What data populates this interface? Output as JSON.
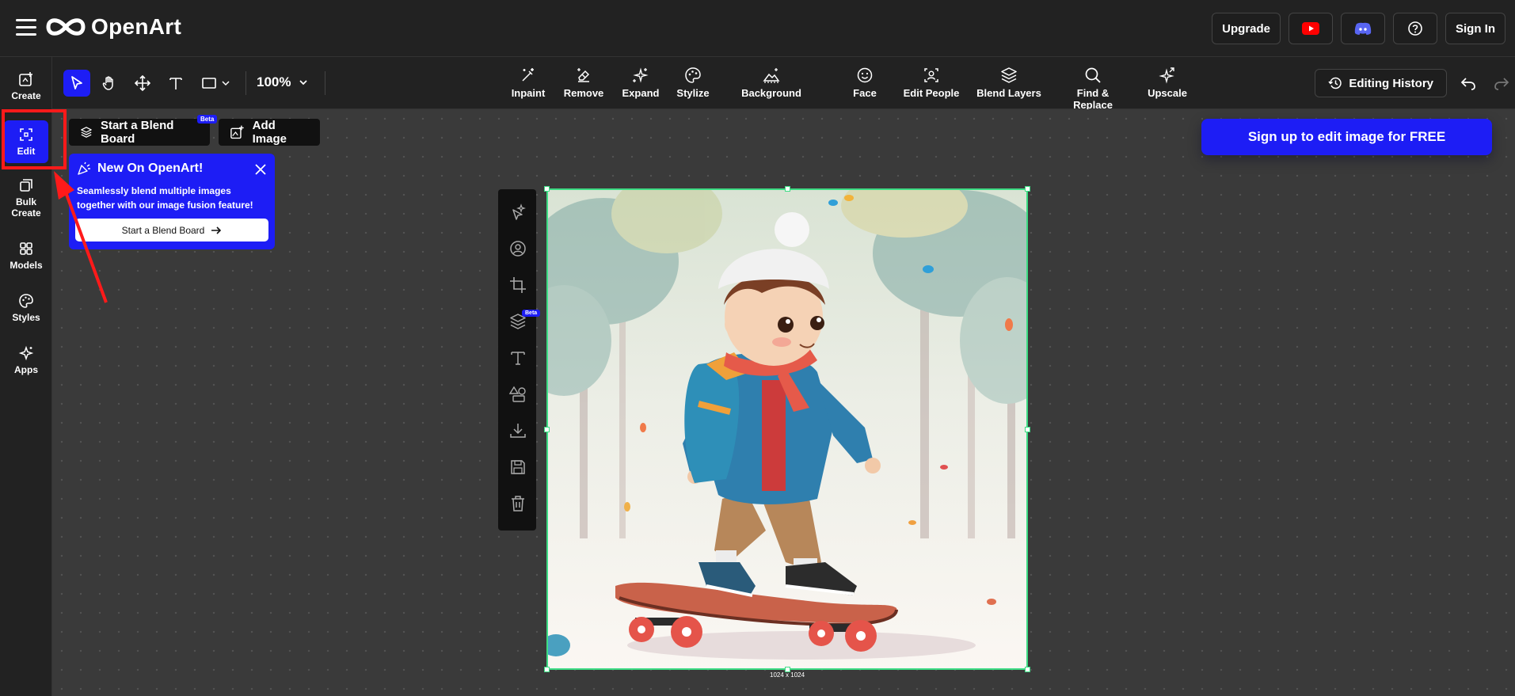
{
  "header": {
    "logo_text": "OpenArt",
    "upgrade_label": "Upgrade",
    "sign_in_label": "Sign In",
    "youtube_icon": "youtube-icon",
    "discord_icon": "discord-icon",
    "help_icon": "help-icon"
  },
  "sidebar": {
    "items": [
      {
        "label": "Create",
        "icon": "create-icon"
      },
      {
        "label": "Edit",
        "icon": "edit-icon",
        "active": true
      },
      {
        "label": "Bulk Create",
        "icon": "bulk-create-icon"
      },
      {
        "label": "Models",
        "icon": "models-icon"
      },
      {
        "label": "Styles",
        "icon": "styles-icon"
      },
      {
        "label": "Apps",
        "icon": "apps-icon"
      }
    ]
  },
  "toolbar": {
    "zoom_value": "100%",
    "features": [
      {
        "label": "Inpaint",
        "icon": "inpaint-icon"
      },
      {
        "label": "Remove",
        "icon": "remove-icon"
      },
      {
        "label": "Expand",
        "icon": "expand-icon"
      },
      {
        "label": "Stylize",
        "icon": "stylize-icon"
      },
      {
        "label": "Background",
        "icon": "background-icon"
      },
      {
        "label": "Face",
        "icon": "face-icon"
      },
      {
        "label": "Edit People",
        "icon": "edit-people-icon"
      },
      {
        "label": "Blend Layers",
        "icon": "blend-layers-icon"
      },
      {
        "label": "Find & Replace",
        "icon": "find-replace-icon"
      },
      {
        "label": "Upscale",
        "icon": "upscale-icon"
      }
    ],
    "editing_history_label": "Editing History"
  },
  "canvas": {
    "blend_board_label": "Start a Blend Board",
    "blend_board_badge": "Beta",
    "add_image_label": "Add Image",
    "layer_badge": "Beta",
    "signup_label": "Sign up to edit image for FREE",
    "image_dimensions": "1024 x 1024"
  },
  "popup": {
    "title": "New On OpenArt!",
    "text": "Seamlessly blend multiple images together with our image fusion feature!",
    "button_label": "Start a Blend Board"
  },
  "colors": {
    "accent": "#1d1df5",
    "selection": "#3ddc84",
    "annotation": "#ff1a1a"
  }
}
